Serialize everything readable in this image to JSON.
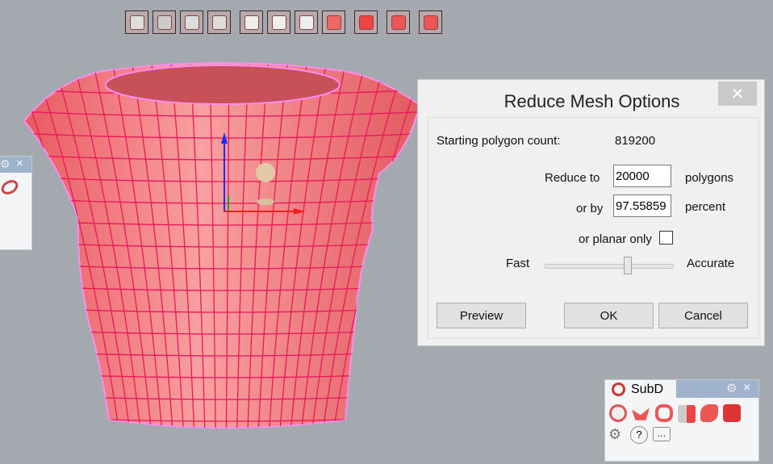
{
  "toolbar": {
    "icons": [
      "gumball-move-icon",
      "gumball-rotate-icon",
      "gumball-scale-icon",
      "gumball-multi-icon",
      "box-vertex-icon",
      "box-edge-icon",
      "box-face-icon",
      "box-solid-icon",
      "history-icon",
      "sphere-subd-icon",
      "cone-icon"
    ]
  },
  "dialog": {
    "title": "Reduce Mesh Options",
    "close": "✕",
    "starting_label": "Starting polygon count:",
    "starting_value": "819200",
    "reduce_to_label": "Reduce to",
    "reduce_to_value": "20000",
    "reduce_to_unit": "polygons",
    "or_by_label": "or by",
    "or_by_value": "97.55859",
    "or_by_unit": "percent",
    "planar_label": "or planar only",
    "planar_checked": false,
    "slider_left": "Fast",
    "slider_right": "Accurate",
    "slider_value": 0.65,
    "preview": "Preview",
    "ok": "OK",
    "cancel": "Cancel"
  },
  "subd_panel": {
    "tab": "SubD",
    "close": "×"
  },
  "left_panel": {
    "close": "×"
  },
  "colors": {
    "mesh": "#f06a70",
    "wire": "#e8185a",
    "outline": "#ff8cf0"
  }
}
